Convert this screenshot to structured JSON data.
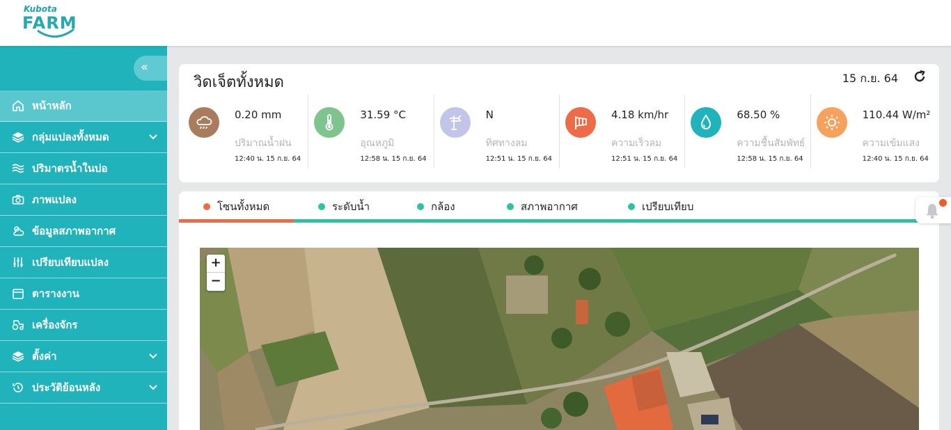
{
  "brand": {
    "small": "Kubota",
    "big": "FARM"
  },
  "sidebar": {
    "collapse_icon": "double-chevron-left-icon",
    "items": [
      {
        "label": "หน้าหลัก",
        "icon": "home-icon",
        "active": true
      },
      {
        "label": "กลุ่มแปลงทั้งหมด",
        "icon": "layers-icon",
        "expandable": true
      },
      {
        "label": "ปริมาตรน้ำในบ่อ",
        "icon": "water-waves-icon"
      },
      {
        "label": "ภาพแปลง",
        "icon": "camera-icon"
      },
      {
        "label": "ข้อมูลสภาพอากาศ",
        "icon": "weather-icon"
      },
      {
        "label": "เปรียบเทียบแปลง",
        "icon": "sliders-icon"
      },
      {
        "label": "ตารางงาน",
        "icon": "calendar-icon"
      },
      {
        "label": "เครื่องจักร",
        "icon": "tractor-icon"
      },
      {
        "label": "ตั้งค่า",
        "icon": "layers-icon",
        "expandable": true
      },
      {
        "label": "ประวัติย้อนหลัง",
        "icon": "history-icon",
        "expandable": true
      }
    ]
  },
  "widgets": {
    "title": "วิดเจ็ตทั้งหมด",
    "date": "15 ก.ย. 64",
    "metrics": [
      {
        "value": "0.20 mm",
        "label": "ปริมาณน้ำฝน",
        "time": "12:40 น. 15 ก.ย. 64",
        "icon": "rain-cloud-icon",
        "color": "#a97c5e"
      },
      {
        "value": "31.59 °C",
        "label": "อุณหภูมิ",
        "time": "12:58 น. 15 ก.ย. 64",
        "icon": "thermometer-icon",
        "color": "#7fc48e"
      },
      {
        "value": "N",
        "label": "ทิศทางลม",
        "time": "12:51 น. 15 ก.ย. 64",
        "icon": "wind-vane-icon",
        "color": "#c3c4ea"
      },
      {
        "value": "4.18 km/hr",
        "label": "ความเร็วลม",
        "time": "12:51 น. 15 ก.ย. 64",
        "icon": "windsock-icon",
        "color": "#ee6b47"
      },
      {
        "value": "68.50 %",
        "label": "ความชื้นสัมพัทธ์",
        "time": "12:58 น. 15 ก.ย. 64",
        "icon": "water-drop-icon",
        "color": "#20b3bc"
      },
      {
        "value": "110.44 W/m²",
        "label": "ความเข้มแสง",
        "time": "12:40 น. 15 ก.ย. 64",
        "icon": "sun-icon",
        "color": "#f7a25c"
      }
    ]
  },
  "tabs": [
    {
      "label": "โซนทั้งหมด",
      "active": true
    },
    {
      "label": "ระดับน้ำ"
    },
    {
      "label": "กล้อง"
    },
    {
      "label": "สภาพอากาศ"
    },
    {
      "label": "เปรียบเทียบ"
    }
  ],
  "map": {
    "zoom_in": "+",
    "zoom_out": "−"
  },
  "colors": {
    "sidebar": "#20b3bc",
    "active_tab": "#ee6b47",
    "tab_accent": "#2bc3a2",
    "badge": "#f05a28"
  }
}
